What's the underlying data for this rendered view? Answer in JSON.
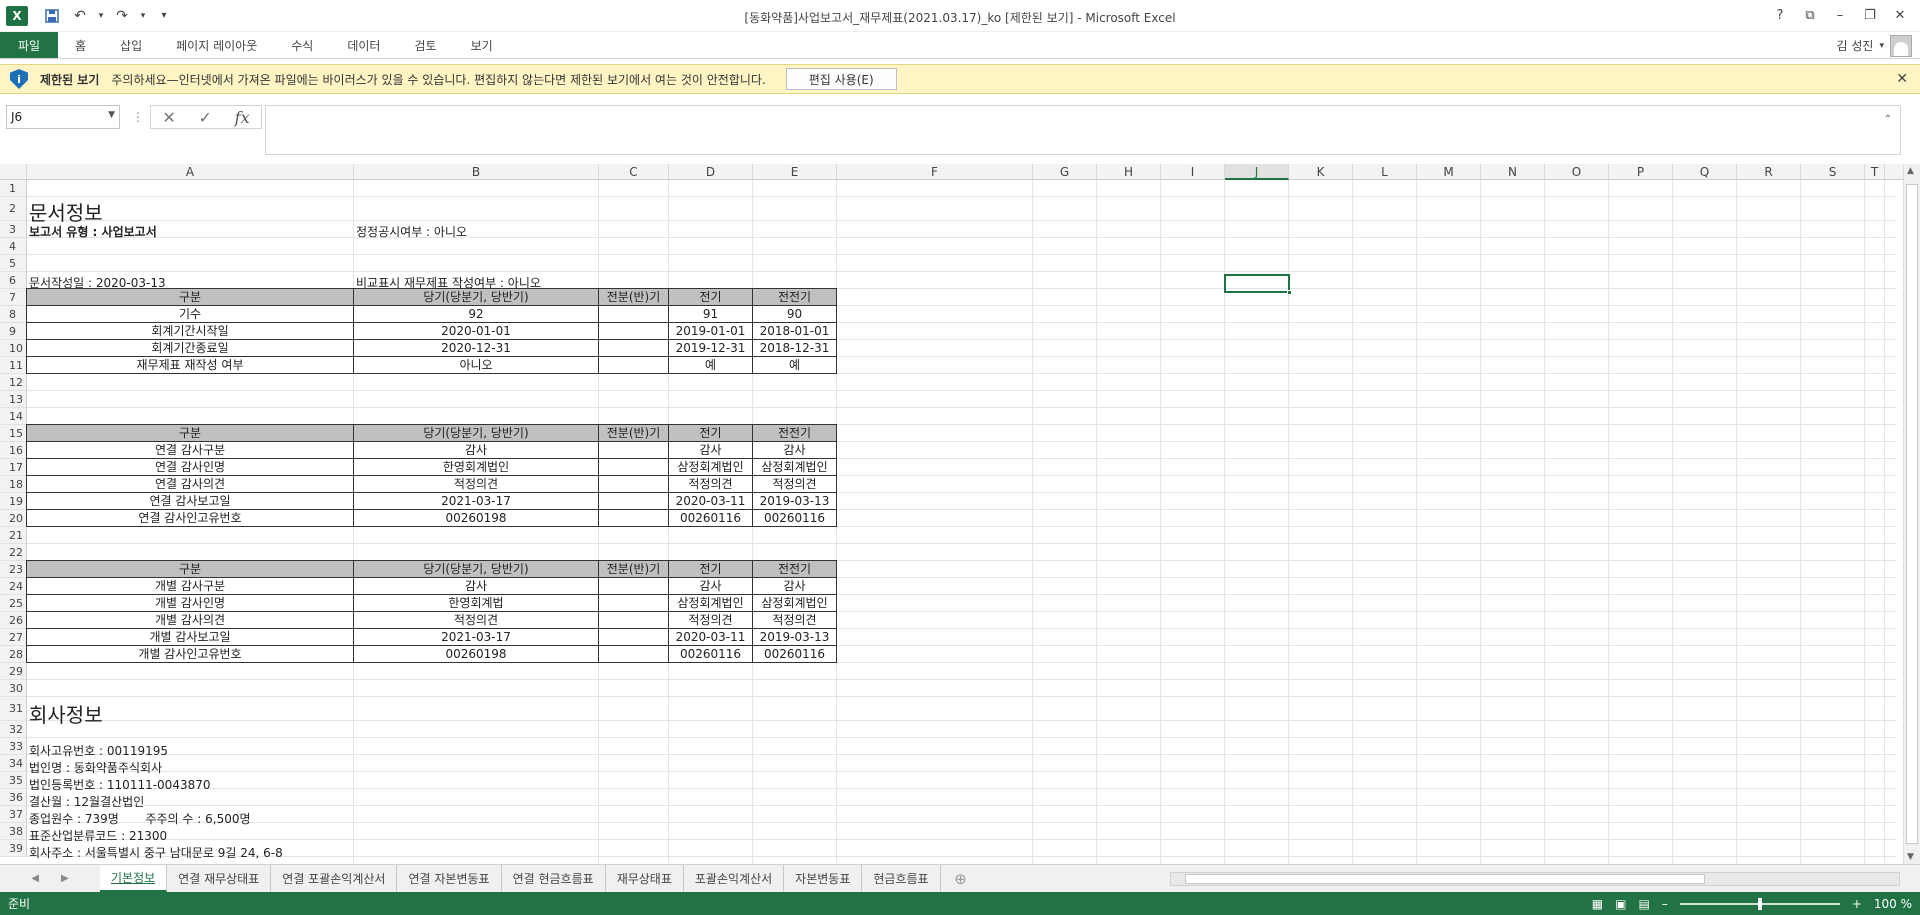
{
  "window": {
    "title": "[동화약품]사업보고서_재무제표(2021.03.17)_ko  [제한된 보기] - Microsoft Excel",
    "app_icon": "X",
    "qat": {
      "save": "save-icon",
      "undo": "undo-icon",
      "redo": "redo-icon",
      "more": "▾"
    },
    "controls": {
      "help": "?",
      "ribbon": "⧉",
      "minimize": "–",
      "restore": "❐",
      "close": "✕"
    }
  },
  "ribbon": {
    "file": "파일",
    "tabs": [
      "홈",
      "삽입",
      "페이지 레이아웃",
      "수식",
      "데이터",
      "검토",
      "보기"
    ],
    "user_name": "김 성진"
  },
  "protected_view": {
    "title": "제한된 보기",
    "message": "주의하세요—인터넷에서 가져온 파일에는 바이러스가 있을 수 있습니다. 편집하지 않는다면 제한된 보기에서 여는 것이 안전합니다.",
    "button": "편집 사용(E)",
    "close": "✕"
  },
  "formula_bar": {
    "name_box": "J6",
    "value": ""
  },
  "columns": [
    "A",
    "B",
    "C",
    "D",
    "E",
    "F",
    "G",
    "H",
    "I",
    "J",
    "K",
    "L",
    "M",
    "N",
    "O",
    "P",
    "Q",
    "R",
    "S",
    "T"
  ],
  "rows": [
    "1",
    "2",
    "3",
    "4",
    "5",
    "6",
    "7",
    "8",
    "9",
    "10",
    "11",
    "12",
    "13",
    "14",
    "15",
    "16",
    "17",
    "18",
    "19",
    "20",
    "21",
    "22",
    "23",
    "24",
    "25",
    "26",
    "27",
    "28",
    "29",
    "30",
    "31",
    "32",
    "33",
    "34",
    "35",
    "36",
    "37",
    "38",
    "39"
  ],
  "sheet": {
    "doc_info_title": "문서정보",
    "report_type": "보고서 유형 : 사업보고서",
    "correction": "정정공시여부 : 아니오",
    "doc_date": "문서작성일 : 2020-03-13",
    "comparison": "비교표시 재무제표 작성여부 : 아니오",
    "headers": [
      "구분",
      "당기(당분기, 당반기)",
      "전분(반)기",
      "전기",
      "전전기"
    ],
    "table1": [
      [
        "기수",
        "92",
        "",
        "91",
        "90"
      ],
      [
        "회계기간시작일",
        "2020-01-01",
        "",
        "2019-01-01",
        "2018-01-01"
      ],
      [
        "회계기간종료일",
        "2020-12-31",
        "",
        "2019-12-31",
        "2018-12-31"
      ],
      [
        "재무제표 재작성 여부",
        "아니오",
        "",
        "예",
        "예"
      ]
    ],
    "table2": [
      [
        "연결 감사구분",
        "감사",
        "",
        "감사",
        "감사"
      ],
      [
        "연결 감사인명",
        "한영회계법인",
        "",
        "삼정회계법인",
        "삼정회계법인"
      ],
      [
        "연결 감사의견",
        "적정의견",
        "",
        "적정의견",
        "적정의견"
      ],
      [
        "연결 감사보고일",
        "2021-03-17",
        "",
        "2020-03-11",
        "2019-03-13"
      ],
      [
        "연결 감사인고유번호",
        "00260198",
        "",
        "00260116",
        "00260116"
      ]
    ],
    "table3": [
      [
        "개별 감사구분",
        "감사",
        "",
        "감사",
        "감사"
      ],
      [
        "개별 감사인명",
        "한영회계법",
        "",
        "삼정회계법인",
        "삼정회계법인"
      ],
      [
        "개별 감사의견",
        "적정의견",
        "",
        "적정의견",
        "적정의견"
      ],
      [
        "개별 감사보고일",
        "2021-03-17",
        "",
        "2020-03-11",
        "2019-03-13"
      ],
      [
        "개별 감사인고유번호",
        "00260198",
        "",
        "00260116",
        "00260116"
      ]
    ],
    "company_title": "회사정보",
    "company": [
      "회사고유번호 : 00119195",
      "법인명 : 동화약품주식회사",
      "법인등록번호 : 110111-0043870",
      "결산월 : 12월결산법인",
      "종업원수 : 739명       주주의 수 : 6,500명",
      "표준산업분류코드 : 21300",
      "회사주소 : 서울특별시 중구 남대문로 9길 24, 6-8"
    ]
  },
  "sheet_tabs": [
    "기본정보",
    "연결 재무상태표",
    "연결 포괄손익계산서",
    "연결 자본변동표",
    "연결 현금흐름표",
    "재무상태표",
    "포괄손익계산서",
    "자본변동표",
    "현금흐름표"
  ],
  "active_sheet": 0,
  "status": {
    "ready": "준비",
    "zoom": "100 %"
  }
}
